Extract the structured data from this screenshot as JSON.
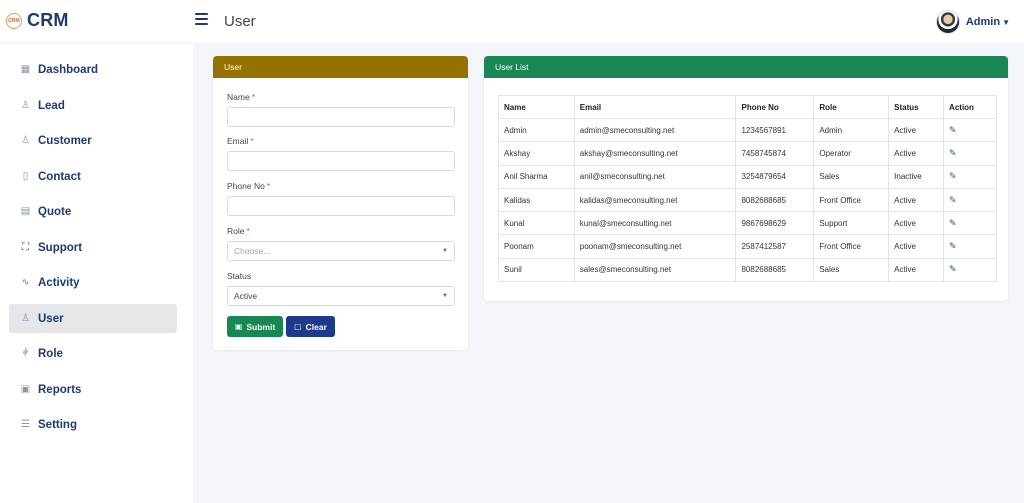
{
  "brand": {
    "logo_text": "CRM",
    "name": "CRM"
  },
  "header": {
    "title": "User",
    "user_name": "Admin"
  },
  "sidebar": {
    "items": [
      {
        "label": "Dashboard",
        "icon": "grid-icon"
      },
      {
        "label": "Lead",
        "icon": "user-plus-icon"
      },
      {
        "label": "Customer",
        "icon": "users-icon"
      },
      {
        "label": "Contact",
        "icon": "phone-icon"
      },
      {
        "label": "Quote",
        "icon": "document-icon"
      },
      {
        "label": "Support",
        "icon": "support-icon"
      },
      {
        "label": "Activity",
        "icon": "activity-icon"
      },
      {
        "label": "User",
        "icon": "user-icon",
        "active": true
      },
      {
        "label": "Role",
        "icon": "sitemap-icon"
      },
      {
        "label": "Reports",
        "icon": "save-icon"
      },
      {
        "label": "Setting",
        "icon": "list-icon"
      }
    ]
  },
  "form_panel": {
    "title": "User",
    "header_color": "#957200",
    "fields": {
      "name": {
        "label": "Name",
        "required_mark": "*",
        "value": ""
      },
      "email": {
        "label": "Email",
        "required_mark": "*",
        "value": ""
      },
      "phone": {
        "label": "Phone No",
        "required_mark": "*",
        "value": ""
      },
      "role": {
        "label": "Role",
        "required_mark": "*",
        "value": "Choose..."
      },
      "status": {
        "label": "Status",
        "value": "Active"
      }
    },
    "submit_label": "Submit",
    "clear_label": "Clear",
    "submit_color": "#198754",
    "clear_color": "#1e3a8a"
  },
  "list_panel": {
    "title": "User List",
    "header_color": "#198754",
    "columns": [
      "Name",
      "Email",
      "Phone No",
      "Role",
      "Status",
      "Action"
    ],
    "rows": [
      [
        "Admin",
        "admin@smeconsulting.net",
        "1234567891",
        "Admin",
        "Active"
      ],
      [
        "Akshay",
        "akshay@smeconsulting.net",
        "7458745874",
        "Operator",
        "Active"
      ],
      [
        "Anil Sharma",
        "anil@smeconsulting.net",
        "3254879654",
        "Sales",
        "Inactive"
      ],
      [
        "Kalidas",
        "kalidas@smeconsulting.net",
        "8082688685",
        "Front Office",
        "Active"
      ],
      [
        "Kunal",
        "kunal@smeconsulting.net",
        "9867698629",
        "Support",
        "Active"
      ],
      [
        "Poonam",
        "poonam@smeconsulting.net",
        "2587412587",
        "Front Office",
        "Active"
      ],
      [
        "Sunil",
        "sales@smeconsulting.net",
        "8082688685",
        "Sales",
        "Active"
      ]
    ]
  }
}
